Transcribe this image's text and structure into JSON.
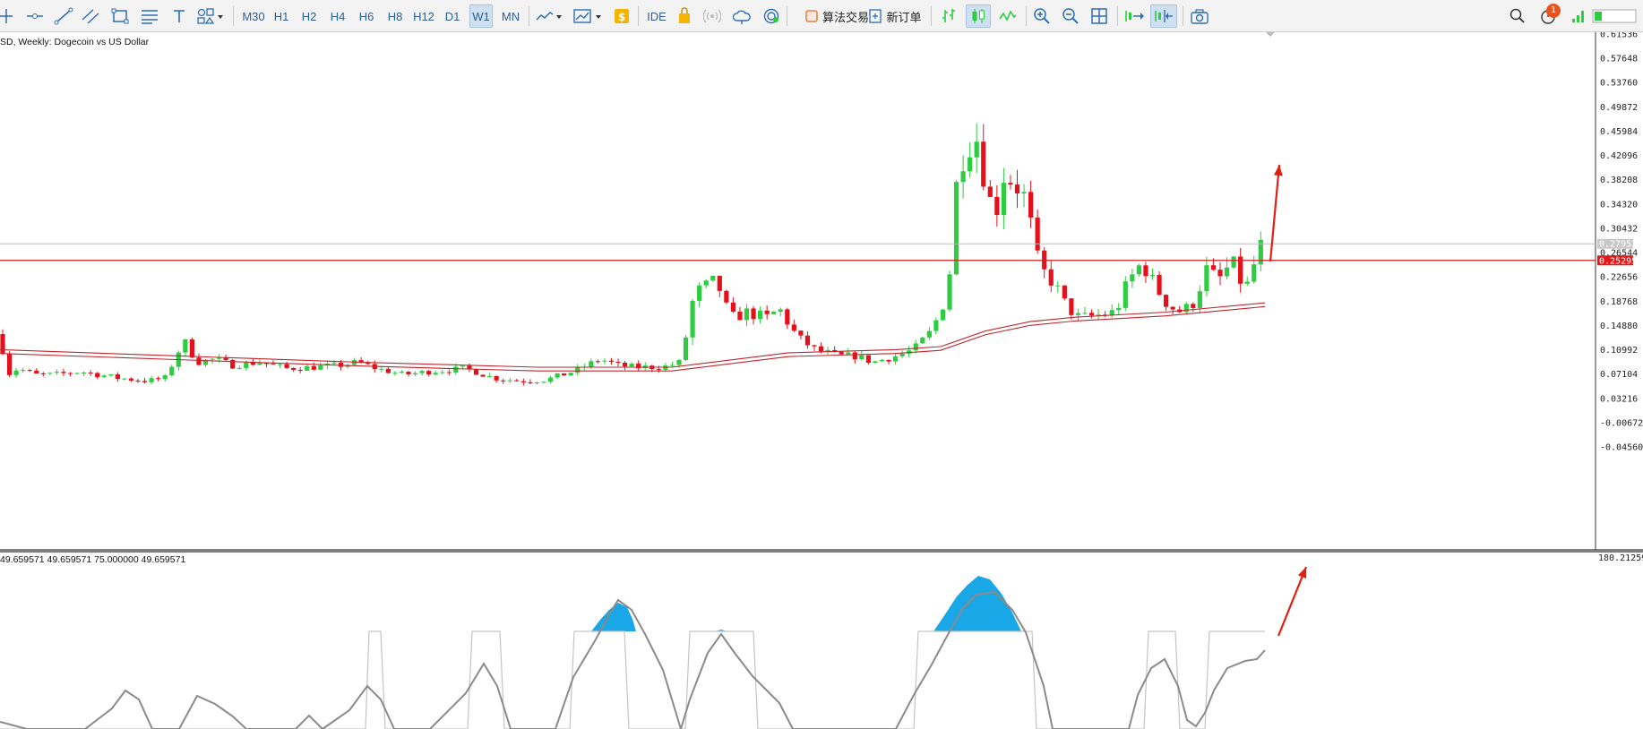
{
  "toolbar": {
    "timeframes": [
      "M30",
      "H1",
      "H2",
      "H4",
      "H6",
      "H8",
      "H12",
      "D1",
      "W1",
      "MN"
    ],
    "active_timeframe": "W1",
    "ide_label": "IDE",
    "algo_trading_label": "算法交易",
    "new_order_label": "新订单",
    "notification_count": "1",
    "icons": [
      "crosshair-icon",
      "horizontal-line-icon",
      "trendline-icon",
      "channel-icon",
      "rectangle-icon",
      "fibonacci-icon",
      "text-icon",
      "shapes-icon",
      "indicators-icon",
      "templates-icon",
      "dollar-icon",
      "market-icon",
      "signals-icon",
      "vps-icon",
      "economic-calendar-icon",
      "bar-chart-icon",
      "candlestick-chart-icon",
      "line-chart-icon",
      "zoom-in-icon",
      "zoom-out-icon",
      "tile-windows-icon",
      "autoscroll-icon",
      "chart-shift-icon",
      "screenshot-icon",
      "search-icon",
      "signal-strength-icon"
    ]
  },
  "main_chart": {
    "label": "SD, Weekly:  Dogecoin vs US Dollar",
    "price_axis": [
      "0.61536",
      "0.57648",
      "0.53760",
      "0.49872",
      "0.45984",
      "0.42096",
      "0.38208",
      "0.34320",
      "0.30432",
      "0.26544",
      "0.22656",
      "0.18768",
      "0.14880",
      "0.10992",
      "0.07104",
      "0.03216",
      "-0.00672",
      "-0.04560"
    ],
    "current_price": "0.27952",
    "level_price": "0.25295",
    "colors": {
      "bull": "#2ecc40",
      "bear": "#e5101a",
      "ma": "#c0262d",
      "level": "#d62020",
      "arrow": "#e02010"
    }
  },
  "indicator": {
    "label": "49.659571 49.659571 75.000000 49.659571",
    "axis_top": "180.212592",
    "fill_color": "#1aa7e8"
  }
}
